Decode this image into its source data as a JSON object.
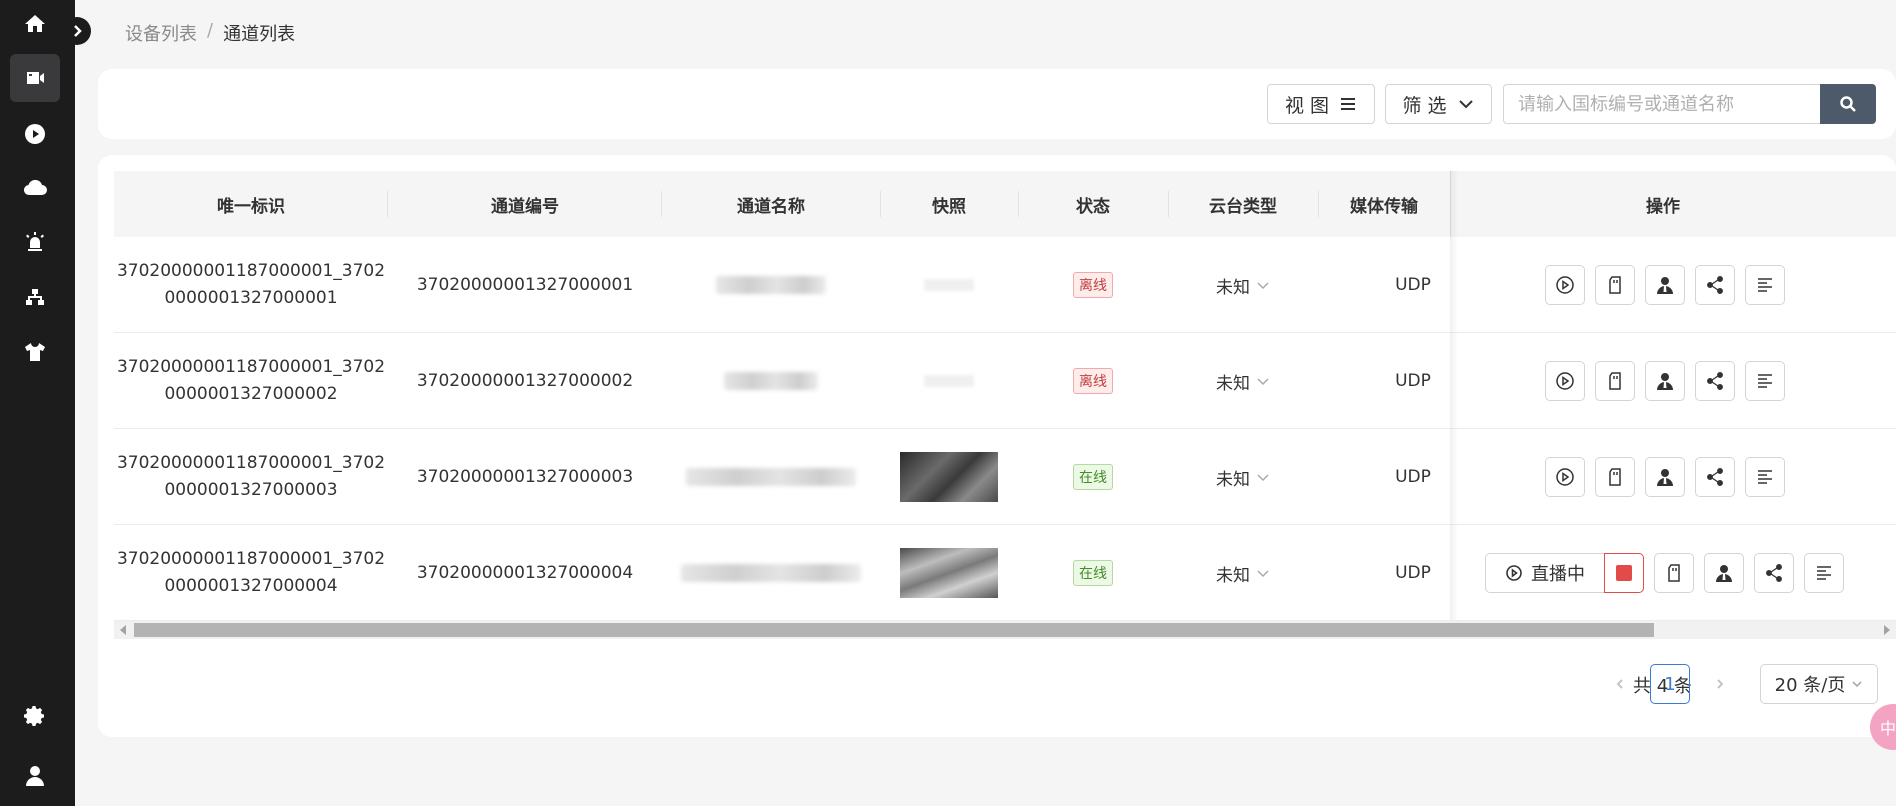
{
  "breadcrumb": {
    "parent": "设备列表",
    "separator": "/",
    "current": "通道列表"
  },
  "toolbar": {
    "view_label": "视 图",
    "filter_label": "筛 选",
    "search_placeholder": "请输入国标编号或通道名称"
  },
  "sidebar": {
    "items": [
      {
        "icon": "home-icon"
      },
      {
        "icon": "camera-icon",
        "active": true
      },
      {
        "icon": "play-icon"
      },
      {
        "icon": "cloud-icon"
      },
      {
        "icon": "alarm-icon"
      },
      {
        "icon": "network-icon"
      },
      {
        "icon": "shirt-icon"
      },
      {
        "icon": "gear-icon"
      },
      {
        "icon": "user-icon"
      }
    ]
  },
  "table": {
    "headers": {
      "unique_id": "唯一标识",
      "channel_no": "通道编号",
      "channel_name": "通道名称",
      "snapshot": "快照",
      "status": "状态",
      "ptz_type": "云台类型",
      "media_transport": "媒体传输",
      "actions": "操作"
    },
    "rows": [
      {
        "unique_id_line1": "37020000001187000001_3702",
        "unique_id_line2": "0000001327000001",
        "channel_no": "37020000001327000001",
        "status": "离线",
        "ptz_type": "未知",
        "media": "UDP"
      },
      {
        "unique_id_line1": "37020000001187000001_3702",
        "unique_id_line2": "0000001327000002",
        "channel_no": "37020000001327000002",
        "status": "离线",
        "ptz_type": "未知",
        "media": "UDP"
      },
      {
        "unique_id_line1": "37020000001187000001_3702",
        "unique_id_line2": "0000001327000003",
        "channel_no": "37020000001327000003",
        "status": "在线",
        "ptz_type": "未知",
        "media": "UDP"
      },
      {
        "unique_id_line1": "37020000001187000001_3702",
        "unique_id_line2": "0000001327000004",
        "channel_no": "37020000001327000004",
        "status": "在线",
        "ptz_type": "未知",
        "media": "UDP",
        "live_label": "直播中"
      }
    ]
  },
  "pagination": {
    "total": "共 4 条",
    "current_page": "1",
    "page_size": "20 条/页"
  },
  "lang_badge": "中",
  "colors": {
    "sidebar_bg": "#1c1c1d",
    "search_button": "#4d5a69",
    "offline": "#c33d3d",
    "online": "#3f8f24",
    "stop": "#e34b4b",
    "page_active": "#3a7bd5"
  }
}
